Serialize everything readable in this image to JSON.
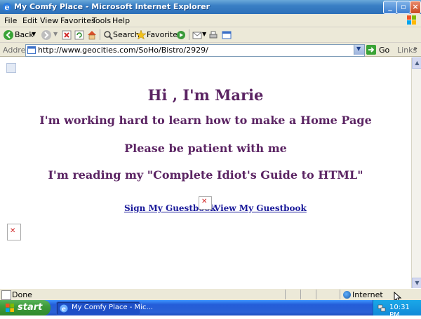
{
  "window": {
    "title": "My Comfy Place - Microsoft Internet Explorer",
    "controls": [
      "minimize-icon",
      "maximize-icon",
      "close-icon"
    ]
  },
  "menu": {
    "items": [
      "File",
      "Edit",
      "View",
      "Favorites",
      "Tools",
      "Help"
    ]
  },
  "toolbar": {
    "back_label": "Back",
    "search_label": "Search",
    "favorites_label": "Favorites"
  },
  "address": {
    "label": "Address",
    "url": "http://www.geocities.com/SoHo/Bistro/2929/",
    "go_label": "Go",
    "links_label": "Links"
  },
  "page": {
    "heading": "Hi , I'm Marie",
    "line1": "I'm working hard to learn how to make a Home Page",
    "line2": "Please be patient with me",
    "line3": "I'm reading my \"Complete Idiot's Guide to HTML\"",
    "sign_link": "Sign My Guestbook",
    "view_link": "View My Guestbook",
    "heading_color": "#5b2463",
    "link_color": "#1a1a9a"
  },
  "status": {
    "text": "Done",
    "zone": "Internet"
  },
  "taskbar": {
    "start_label": "start",
    "task_label": "My Comfy Place - Mic...",
    "clock": "10:31 PM"
  }
}
